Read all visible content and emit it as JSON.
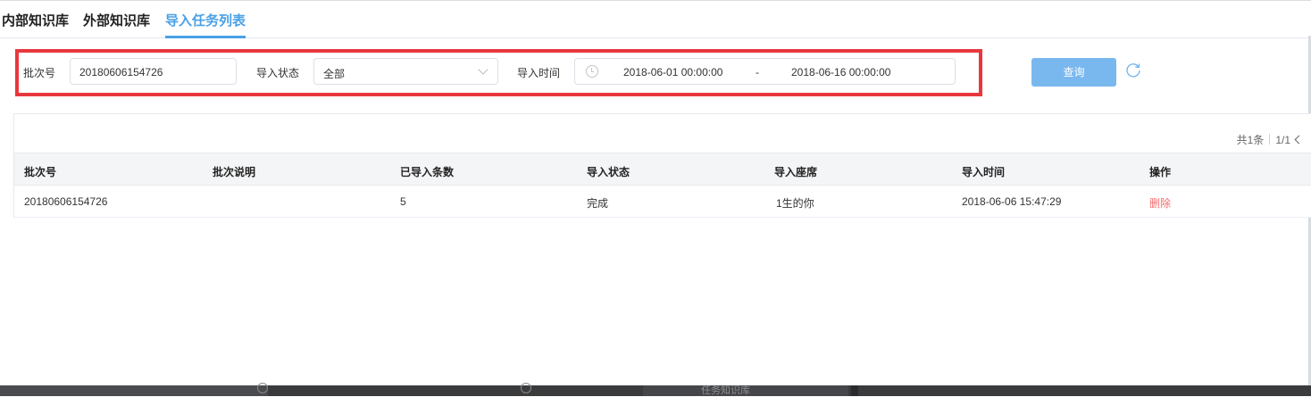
{
  "tabs": [
    {
      "label": "内部知识库",
      "active": false
    },
    {
      "label": "外部知识库",
      "active": false
    },
    {
      "label": "导入任务列表",
      "active": true
    }
  ],
  "filters": {
    "batch_no_label": "批次号",
    "batch_no_value": "20180606154726",
    "status_label": "导入状态",
    "status_value": "全部",
    "time_label": "导入时间",
    "time_start": "2018-06-01 00:00:00",
    "time_separator": "-",
    "time_end": "2018-06-16 00:00:00",
    "query_label": "查询"
  },
  "pagination": {
    "total": "共1条",
    "page": "1/1"
  },
  "table": {
    "columns": [
      "批次号",
      "批次说明",
      "已导入条数",
      "导入状态",
      "导入座席",
      "导入时间",
      "操作"
    ],
    "rows": [
      {
        "batch_no": "20180606154726",
        "description": "",
        "imported_count": "5",
        "status": "完成",
        "agent": "1生的你",
        "time": "2018-06-06 15:47:29",
        "action": "删除"
      }
    ]
  },
  "taskbar": {
    "partial_label": "任务知识库"
  },
  "colors": {
    "accent": "#4aa0e6",
    "highlight_border": "#e8383d",
    "delete_text": "#f56c6c",
    "query_button": "#79b8ef"
  }
}
